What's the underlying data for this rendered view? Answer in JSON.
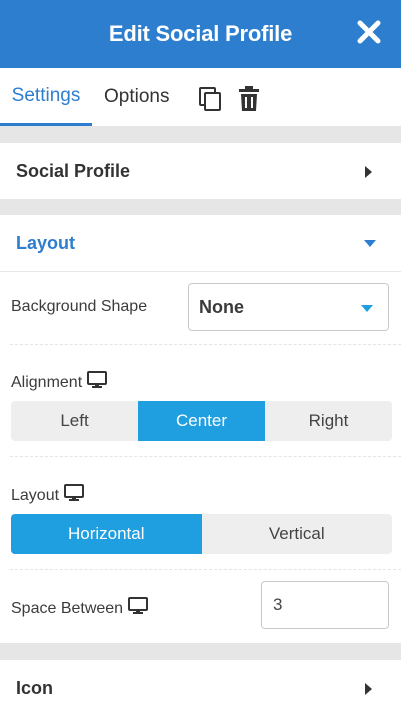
{
  "header": {
    "title": "Edit Social Profile",
    "close_icon": "close-icon"
  },
  "tabs": {
    "settings": "Settings",
    "options": "Options",
    "duplicate_icon": "copy-icon",
    "delete_icon": "trash-icon"
  },
  "sections": {
    "social_profile": "Social Profile",
    "layout": "Layout",
    "icon": "Icon"
  },
  "fields": {
    "background_shape": {
      "label": "Background Shape",
      "value": "None"
    },
    "alignment": {
      "label": "Alignment",
      "options": [
        "Left",
        "Center",
        "Right"
      ],
      "selected": "Center"
    },
    "layout": {
      "label": "Layout",
      "options": [
        "Horizontal",
        "Vertical"
      ],
      "selected": "Horizontal"
    },
    "space_between": {
      "label": "Space Between",
      "value": "3"
    }
  },
  "colors": {
    "accent": "#2d7ecf",
    "active_segment": "#1f9ee0",
    "separator": "#e6e6e6"
  }
}
